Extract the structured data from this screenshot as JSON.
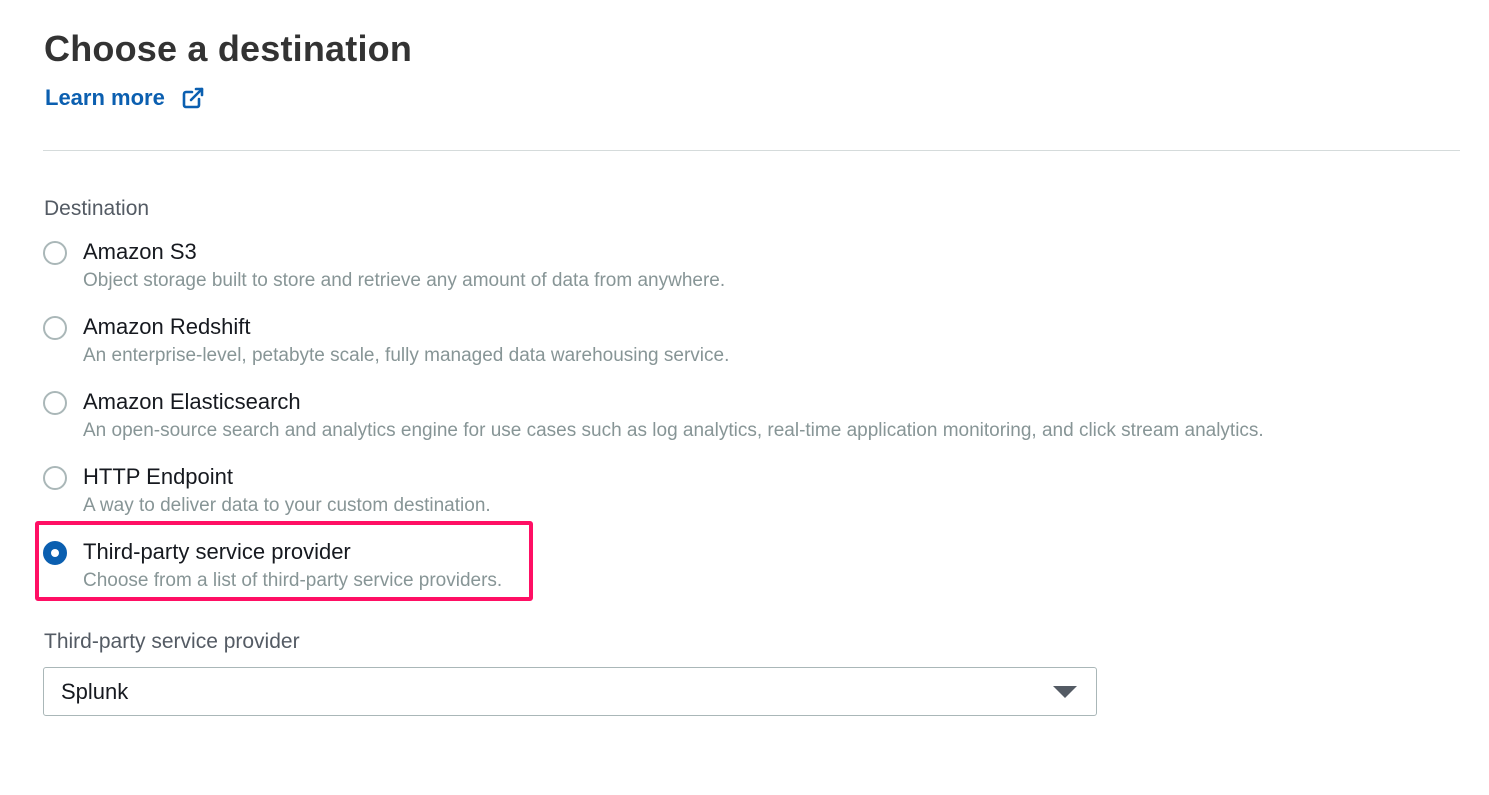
{
  "header": {
    "title": "Choose a destination",
    "learn_more_label": "Learn more"
  },
  "destination": {
    "label": "Destination",
    "options": [
      {
        "title": "Amazon S3",
        "description": "Object storage built to store and retrieve any amount of data from anywhere.",
        "selected": false
      },
      {
        "title": "Amazon Redshift",
        "description": "An enterprise-level, petabyte scale, fully managed data warehousing service.",
        "selected": false
      },
      {
        "title": "Amazon Elasticsearch",
        "description": "An open-source search and analytics engine for use cases such as log analytics, real-time application monitoring, and click stream analytics.",
        "selected": false
      },
      {
        "title": "HTTP Endpoint",
        "description": "A way to deliver data to your custom destination.",
        "selected": false
      },
      {
        "title": "Third-party service provider",
        "description": "Choose from a list of third-party service providers.",
        "selected": true
      }
    ]
  },
  "provider": {
    "label": "Third-party service provider",
    "selected_value": "Splunk"
  },
  "colors": {
    "accent": "#0b5fb0",
    "highlight": "#ff0f64"
  },
  "icons": {
    "external_link": "external-link-icon",
    "dropdown": "caret-down-icon"
  }
}
